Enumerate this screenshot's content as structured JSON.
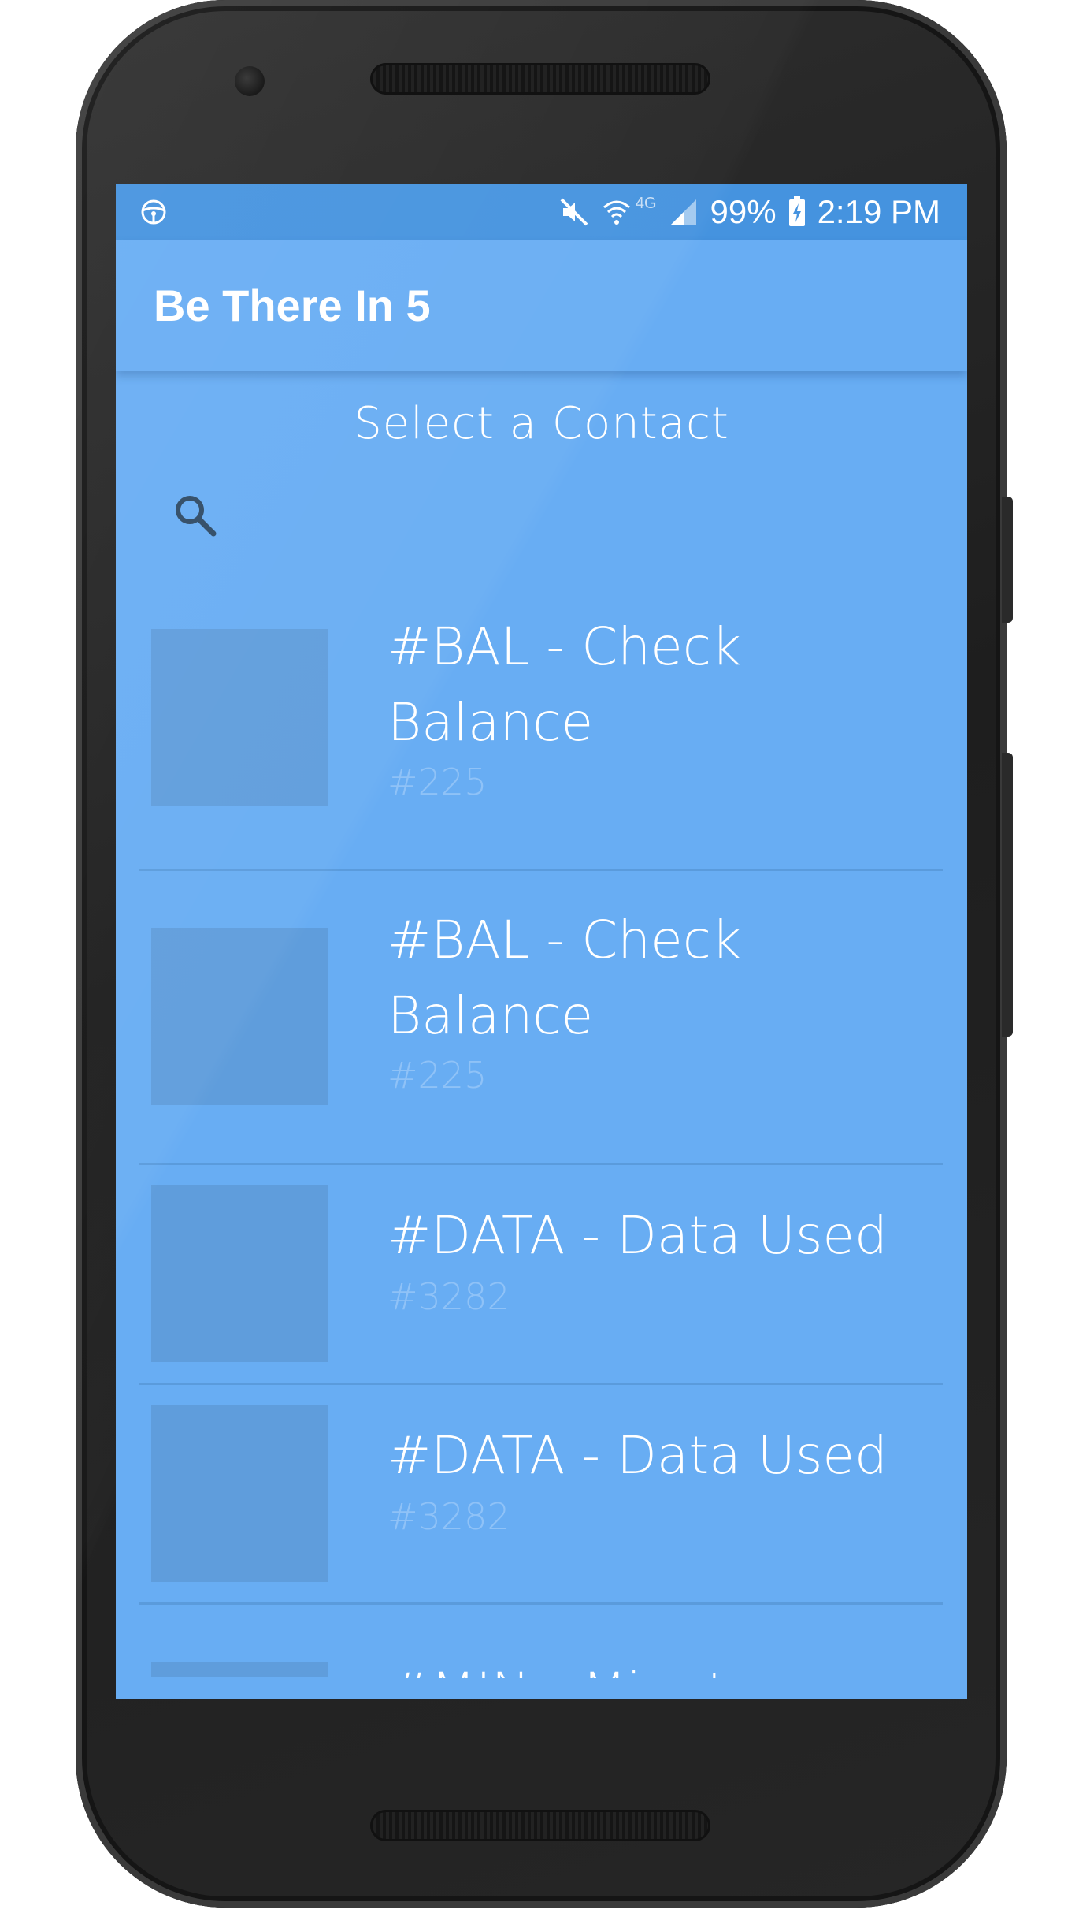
{
  "status_bar": {
    "battery": "99%",
    "time": "2:19 PM",
    "network": "4G",
    "icons": [
      "steering-wheel-icon",
      "mute-icon",
      "wifi-icon",
      "signal-icon",
      "battery-charging-icon"
    ]
  },
  "app_bar": {
    "title": "Be There In 5"
  },
  "main": {
    "section_title": "Select a Contact",
    "search_icon": "search-icon",
    "contacts": [
      {
        "name": "#BAL - Check Balance",
        "number": "#225"
      },
      {
        "name": "#BAL - Check Balance",
        "number": "#225"
      },
      {
        "name": "#DATA - Data Used",
        "number": "#3282"
      },
      {
        "name": "#DATA - Data Used",
        "number": "#3282"
      },
      {
        "name": "#MIN - Minutes",
        "number": ""
      }
    ]
  },
  "colors": {
    "background": "#68adf3",
    "status_bar": "#4593df",
    "avatar_placeholder": "#5f9ddc",
    "number_text": "#8fc2f7"
  }
}
